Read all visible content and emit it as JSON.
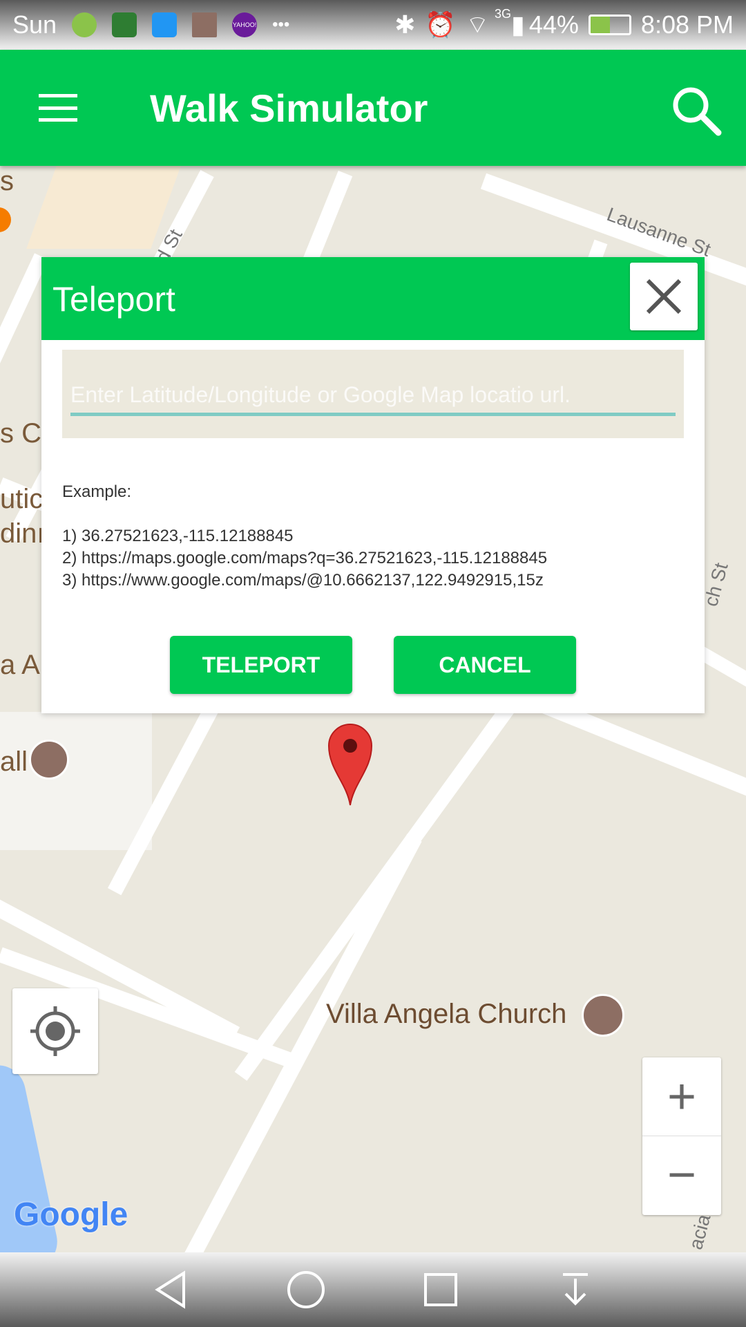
{
  "status_bar": {
    "carrier": "Sun",
    "network": "3G",
    "battery": "44%",
    "time": "8:08 PM",
    "notification_icons": [
      "app-icon",
      "vpn-icon",
      "usb-icon",
      "photo-icon",
      "yahoo-icon"
    ],
    "yahoo": "YAHOO!",
    "more": "•••"
  },
  "app_bar": {
    "title": "Walk Simulator",
    "menu_icon": "hamburger-icon",
    "search_icon": "search-icon"
  },
  "dialog": {
    "title": "Teleport",
    "input_placeholder": "Enter Latitude/Longitude or Google Map locatio url.",
    "input_value": "",
    "example_label": "Example:",
    "examples": [
      "1) 36.27521623,-115.12188845",
      "2) https://maps.google.com/maps?q=36.27521623,-115.12188845",
      "3) https://www.google.com/maps/@10.6662137,122.9492915,15z"
    ],
    "teleport_label": "TELEPORT",
    "cancel_label": "CANCEL"
  },
  "map": {
    "labels": {
      "church": "Villa Angela Church",
      "lausanne": "Lausanne St",
      "d_st": "d St",
      "ch_st": "ch St",
      "acia_st": "acia St",
      "p1": "s",
      "p2": "s Co",
      "p3": "utic",
      "p4": "dinı",
      "p5": "a A",
      "p6": "all"
    },
    "logo": "Google",
    "zoom_in": "+",
    "zoom_out": "−"
  },
  "colors": {
    "accent": "#00c853",
    "input_underline": "#80cbc4",
    "pin": "#e53935"
  }
}
